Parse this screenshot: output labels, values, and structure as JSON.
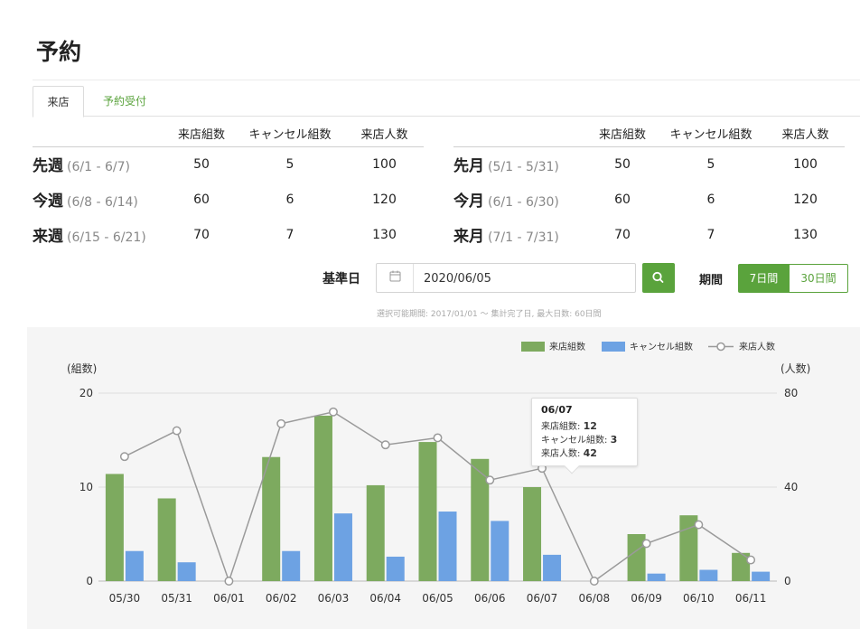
{
  "page": {
    "title": "予約"
  },
  "tabs": [
    {
      "label": "来店",
      "active": true
    },
    {
      "label": "予約受付",
      "active": false
    }
  ],
  "weekly": {
    "headers": [
      "来店組数",
      "キャンセル組数",
      "来店人数"
    ],
    "rows": [
      {
        "name": "先週",
        "range": "(6/1 - 6/7)",
        "visits": "50",
        "cancels": "5",
        "people": "100"
      },
      {
        "name": "今週",
        "range": "(6/8 - 6/14)",
        "visits": "60",
        "cancels": "6",
        "people": "120"
      },
      {
        "name": "来週",
        "range": "(6/15 - 6/21)",
        "visits": "70",
        "cancels": "7",
        "people": "130"
      }
    ]
  },
  "monthly": {
    "headers": [
      "来店組数",
      "キャンセル組数",
      "来店人数"
    ],
    "rows": [
      {
        "name": "先月",
        "range": "(5/1 - 5/31)",
        "visits": "50",
        "cancels": "5",
        "people": "100"
      },
      {
        "name": "今月",
        "range": "(6/1 - 6/30)",
        "visits": "60",
        "cancels": "6",
        "people": "120"
      },
      {
        "name": "来月",
        "range": "(7/1 - 7/31)",
        "visits": "70",
        "cancels": "7",
        "people": "130"
      }
    ]
  },
  "controls": {
    "date_label": "基準日",
    "date_value": "2020/06/05",
    "period_label": "期間",
    "period_options": [
      "7日間",
      "30日間"
    ],
    "selected_period": "7日間",
    "hint": "選択可能期間: 2017/01/01 〜 集計完了日, 最大日数: 60日間"
  },
  "colors": {
    "accent": "#5aa33c",
    "visits": "#7daa5f",
    "cancels": "#6da2e3",
    "people": "#9a9a9a"
  },
  "tooltip": {
    "date": "06/07",
    "rows": [
      {
        "label": "来店組数:",
        "value": "12"
      },
      {
        "label": "キャンセル組数:",
        "value": "3"
      },
      {
        "label": "来店人数:",
        "value": "42"
      }
    ]
  },
  "chart_data": {
    "type": "bar",
    "categories": [
      "05/30",
      "05/31",
      "06/01",
      "06/02",
      "06/03",
      "06/04",
      "06/05",
      "06/06",
      "06/07",
      "06/08",
      "06/09",
      "06/10",
      "06/11"
    ],
    "series": [
      {
        "name": "来店組数",
        "type": "bar",
        "axis": "left",
        "values": [
          11.4,
          8.8,
          0,
          13.2,
          17.6,
          10.2,
          14.8,
          13,
          10,
          0,
          5,
          7,
          3
        ]
      },
      {
        "name": "キャンセル組数",
        "type": "bar",
        "axis": "left",
        "values": [
          3.2,
          2,
          0,
          3.2,
          7.2,
          2.6,
          7.4,
          6.4,
          2.8,
          0,
          0.8,
          1.2,
          1
        ]
      },
      {
        "name": "来店人数",
        "type": "line",
        "axis": "right",
        "values": [
          53,
          64,
          0,
          67,
          72,
          58,
          61,
          43,
          48,
          0,
          16,
          24,
          9
        ]
      }
    ],
    "ylabel_left": "(組数)",
    "ylabel_right": "(人数)",
    "ylim_left": [
      0,
      20
    ],
    "yticks_left": [
      0,
      10,
      20
    ],
    "ylim_right": [
      0,
      80
    ],
    "yticks_right": [
      0,
      40,
      80
    ],
    "grid": true,
    "legend": "top-right"
  }
}
